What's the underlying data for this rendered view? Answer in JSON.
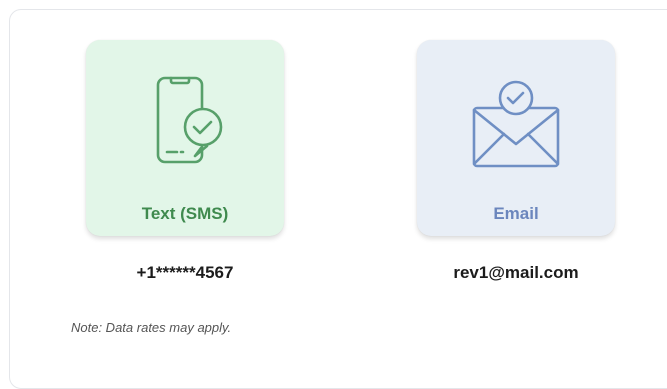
{
  "options": [
    {
      "label": "Text (SMS)",
      "value": "+1******4567",
      "icon": "phone-message-check-icon",
      "color": "#3f8a4e",
      "background": "#e2f6e8"
    },
    {
      "label": "Email",
      "value": "rev1@mail.com",
      "icon": "envelope-check-icon",
      "color": "#6b86bd",
      "background": "#e8eef6"
    }
  ],
  "note": "Note: Data rates may apply."
}
